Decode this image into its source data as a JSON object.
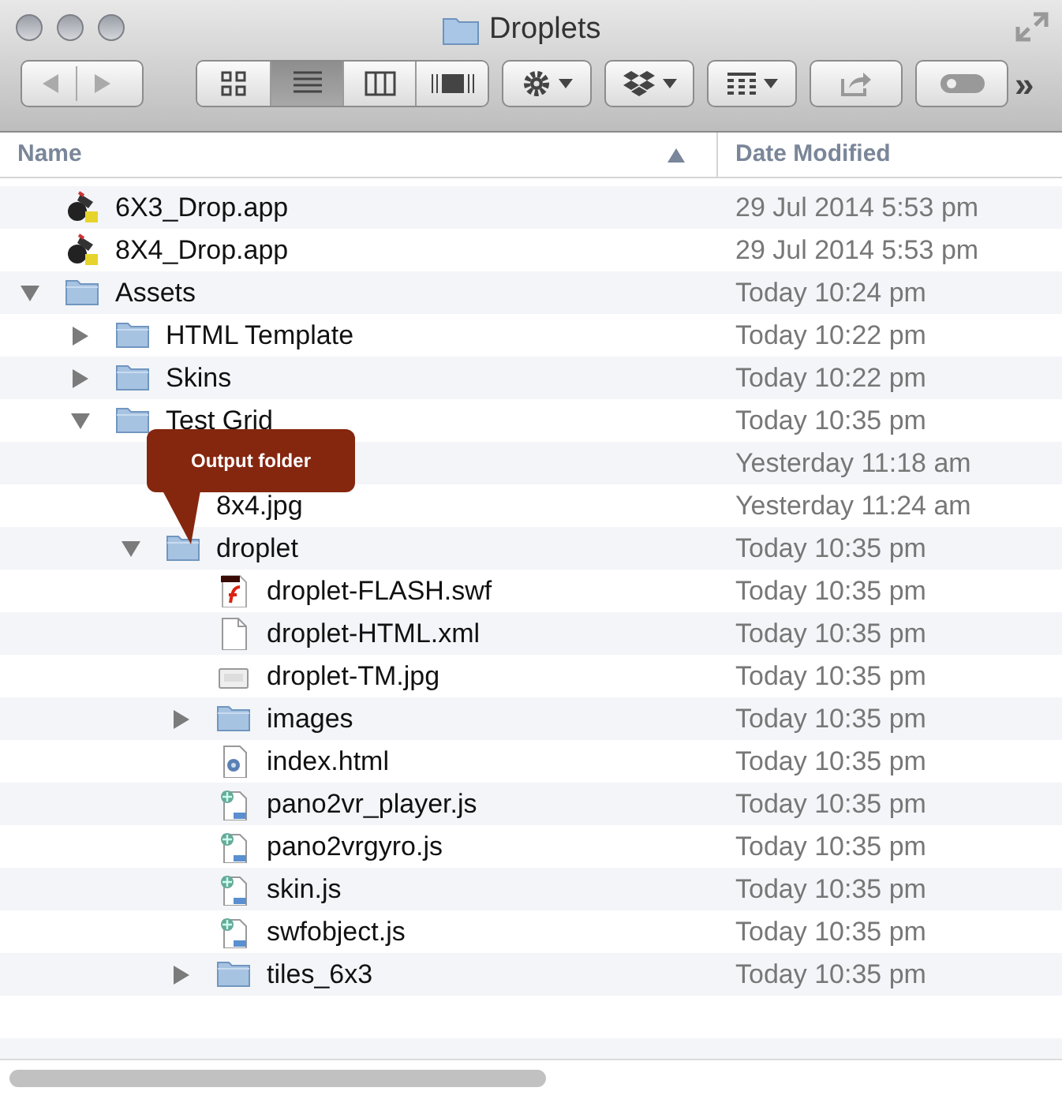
{
  "window": {
    "title": "Droplets"
  },
  "toolbar": {
    "view_modes": [
      {
        "kind": "icons",
        "selected": false
      },
      {
        "kind": "list",
        "selected": true
      },
      {
        "kind": "columns",
        "selected": false
      },
      {
        "kind": "coverflow",
        "selected": false
      }
    ],
    "overflow": "»"
  },
  "columns": [
    {
      "label": "Name",
      "sorted_ascending": true
    },
    {
      "label": "Date Modified"
    }
  ],
  "rows": [
    {
      "kind": "app",
      "name": "6X3_Drop.app",
      "date": "29 Jul 2014 5:53 pm"
    },
    {
      "kind": "app",
      "name": "8X4_Drop.app",
      "date": "29 Jul 2014 5:53 pm"
    },
    {
      "kind": "folder",
      "name": "Assets",
      "date": "Today 10:24 pm",
      "expanded": true,
      "children": [
        {
          "kind": "folder",
          "name": "HTML Template",
          "date": "Today 10:22 pm",
          "expanded": false
        },
        {
          "kind": "folder",
          "name": "Skins",
          "date": "Today 10:22 pm",
          "expanded": false
        },
        {
          "kind": "folder",
          "name": "Test Grid",
          "date": "Today 10:35 pm",
          "expanded": true,
          "children": [
            {
              "kind": "hidden",
              "date": "Yesterday 11:18 am"
            },
            {
              "kind": "hidden",
              "name": "8x4.jpg",
              "date": "Yesterday 11:24 am"
            },
            {
              "kind": "folder",
              "name": "droplet",
              "date": "Today 10:35 pm",
              "expanded": true,
              "children": [
                {
                  "kind": "flash",
                  "name": "droplet-FLASH.swf",
                  "date": "Today 10:35 pm"
                },
                {
                  "kind": "doc",
                  "name": "droplet-HTML.xml",
                  "date": "Today 10:35 pm"
                },
                {
                  "kind": "image",
                  "name": "droplet-TM.jpg",
                  "date": "Today 10:35 pm"
                },
                {
                  "kind": "folder",
                  "name": "images",
                  "date": "Today 10:35 pm",
                  "expanded": false
                },
                {
                  "kind": "html",
                  "name": "index.html",
                  "date": "Today 10:35 pm"
                },
                {
                  "kind": "script",
                  "name": "pano2vr_player.js",
                  "date": "Today 10:35 pm"
                },
                {
                  "kind": "script",
                  "name": "pano2vrgyro.js",
                  "date": "Today 10:35 pm"
                },
                {
                  "kind": "script",
                  "name": "skin.js",
                  "date": "Today 10:35 pm"
                },
                {
                  "kind": "script",
                  "name": "swfobject.js",
                  "date": "Today 10:35 pm"
                },
                {
                  "kind": "folder",
                  "name": "tiles_6x3",
                  "date": "Today 10:35 pm",
                  "expanded": false
                }
              ]
            }
          ]
        }
      ]
    }
  ],
  "callout": {
    "text": "Output folder"
  }
}
